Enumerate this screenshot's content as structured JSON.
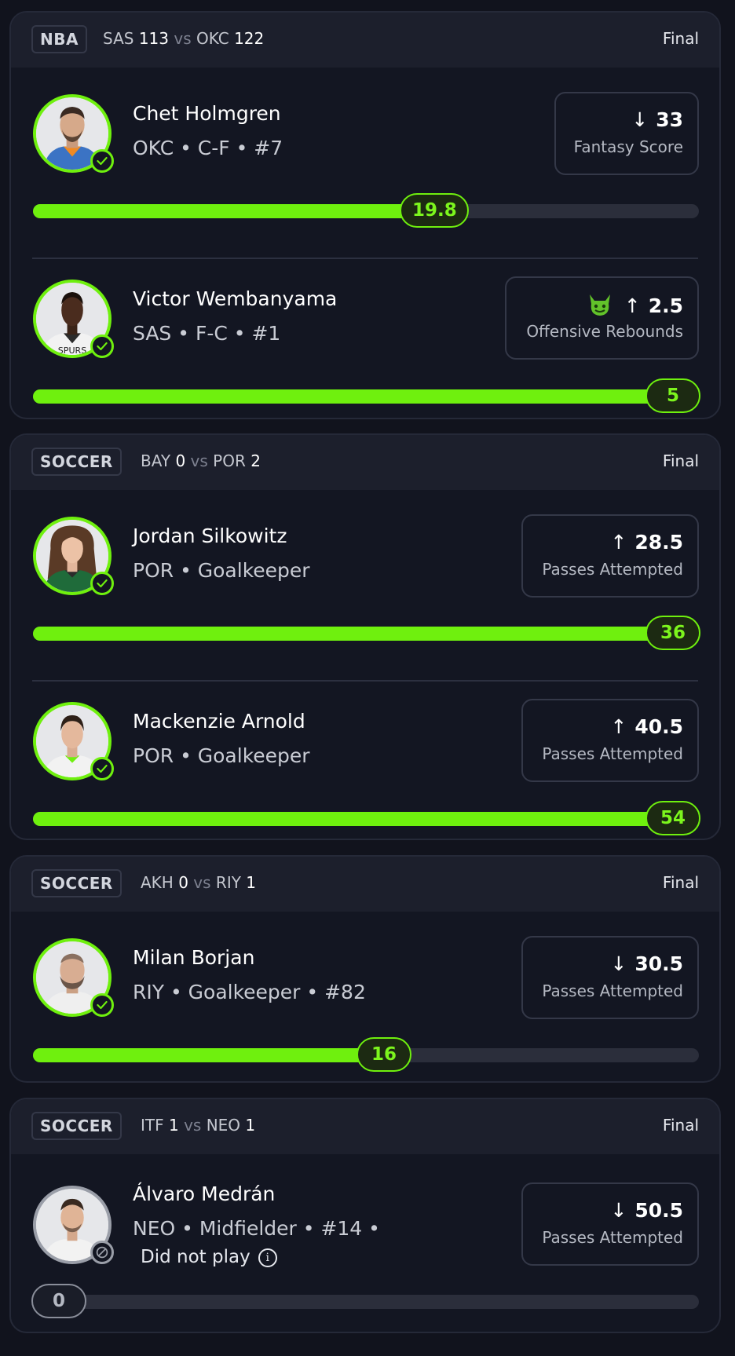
{
  "colors": {
    "accent": "#6ff00e",
    "background": "#11131d",
    "card": "#131622",
    "header": "#1c1f2c"
  },
  "games": [
    {
      "league": "NBA",
      "away_team": "SAS",
      "away_score": "113",
      "vs": "vs",
      "home_team": "OKC",
      "home_score": "122",
      "status": "Final",
      "picks": [
        {
          "name": "Chet Holmgren",
          "meta": "OKC • C-F • #7",
          "direction_icon": "arrow-down-icon",
          "direction": "↓",
          "line": "33",
          "stat": "Fantasy Score",
          "result": "19.8",
          "progress": 0.6,
          "check_icon": "check-icon"
        },
        {
          "name": "Victor Wembanyama",
          "meta": "SAS • F-C • #1",
          "badge_icon": "demon-icon",
          "direction_icon": "arrow-up-icon",
          "direction": "↑",
          "line": "2.5",
          "stat": "Offensive Rebounds",
          "result": "5",
          "progress": 1.0,
          "check_icon": "check-icon"
        }
      ]
    },
    {
      "league": "SOCCER",
      "away_team": "BAY",
      "away_score": "0",
      "vs": "vs",
      "home_team": "POR",
      "home_score": "2",
      "status": "Final",
      "picks": [
        {
          "name": "Jordan Silkowitz",
          "meta": "POR • Goalkeeper",
          "direction_icon": "arrow-up-icon",
          "direction": "↑",
          "line": "28.5",
          "stat": "Passes Attempted",
          "result": "36",
          "progress": 1.0,
          "check_icon": "check-icon"
        },
        {
          "name": "Mackenzie Arnold",
          "meta": "POR • Goalkeeper",
          "direction_icon": "arrow-up-icon",
          "direction": "↑",
          "line": "40.5",
          "stat": "Passes Attempted",
          "result": "54",
          "progress": 1.0,
          "check_icon": "check-icon"
        }
      ]
    },
    {
      "league": "SOCCER",
      "away_team": "AKH",
      "away_score": "0",
      "vs": "vs",
      "home_team": "RIY",
      "home_score": "1",
      "status": "Final",
      "picks": [
        {
          "name": "Milan Borjan",
          "meta": "RIY • Goalkeeper • #82",
          "direction_icon": "arrow-down-icon",
          "direction": "↓",
          "line": "30.5",
          "stat": "Passes Attempted",
          "result": "16",
          "progress": 0.53,
          "check_icon": "check-icon"
        }
      ]
    },
    {
      "league": "SOCCER",
      "away_team": "ITF",
      "away_score": "1",
      "vs": "vs",
      "home_team": "NEO",
      "home_score": "1",
      "status": "Final",
      "picks": [
        {
          "name": "Álvaro Medrán",
          "meta": "NEO • Midfielder • #14 •",
          "meta2": "Did not play",
          "info_icon": "info-icon",
          "direction_icon": "arrow-down-icon",
          "direction": "↓",
          "line": "50.5",
          "stat": "Passes Attempted",
          "result": "0",
          "progress": 0.0,
          "check_icon": "did-not-play-icon"
        }
      ]
    }
  ]
}
